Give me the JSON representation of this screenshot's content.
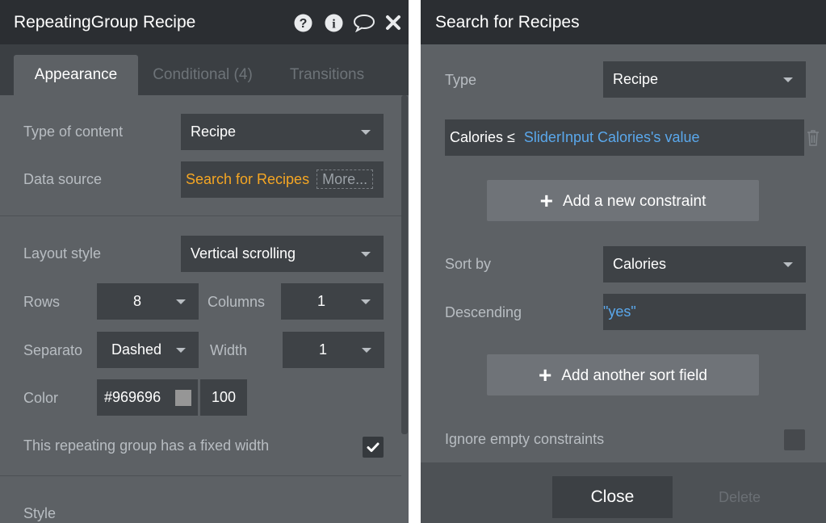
{
  "left": {
    "title": "RepeatingGroup Recipe",
    "title_icons": [
      "question-circle-icon",
      "info-circle-icon",
      "comment-icon",
      "close-icon"
    ],
    "tabs": [
      {
        "label": "Appearance",
        "active": true
      },
      {
        "label": "Conditional (4)",
        "active": false
      },
      {
        "label": "Transitions",
        "active": false
      }
    ],
    "type_of_content": {
      "label": "Type of content",
      "value": "Recipe"
    },
    "data_source": {
      "label": "Data source",
      "value": "Search for Recipes",
      "more": "More..."
    },
    "layout_style": {
      "label": "Layout style",
      "value": "Vertical scrolling"
    },
    "rows": {
      "label": "Rows",
      "value": "8"
    },
    "columns": {
      "label": "Columns",
      "value": "1"
    },
    "separator": {
      "label": "Separato",
      "value": "Dashed"
    },
    "width": {
      "label": "Width",
      "value": "1"
    },
    "color": {
      "label": "Color",
      "hex": "#969696",
      "swatch": "#969696",
      "opacity": "100"
    },
    "fixed_width": {
      "label": "This repeating group has a fixed width",
      "checked": true
    },
    "style": {
      "label": "Style",
      "value": ""
    }
  },
  "right": {
    "title": "Search for Recipes",
    "type": {
      "label": "Type",
      "value": "Recipe"
    },
    "constraint": {
      "field": "Calories ≤",
      "value": "SliderInput Calories's value"
    },
    "add_constraint": "Add a new constraint",
    "sort_by": {
      "label": "Sort by",
      "value": "Calories"
    },
    "descending": {
      "label": "Descending",
      "value": "\"yes\""
    },
    "add_sort": "Add another sort field",
    "ignore_empty": {
      "label": "Ignore empty constraints",
      "checked": false
    },
    "close_label": "Close",
    "delete_label": "Delete"
  },
  "colors": {
    "panel_bg": "#5d6165",
    "titlebar_bg": "#2b2e32",
    "field_bg": "#3e4246",
    "accent_orange": "#f5a623",
    "accent_blue": "#5aa8ec"
  }
}
